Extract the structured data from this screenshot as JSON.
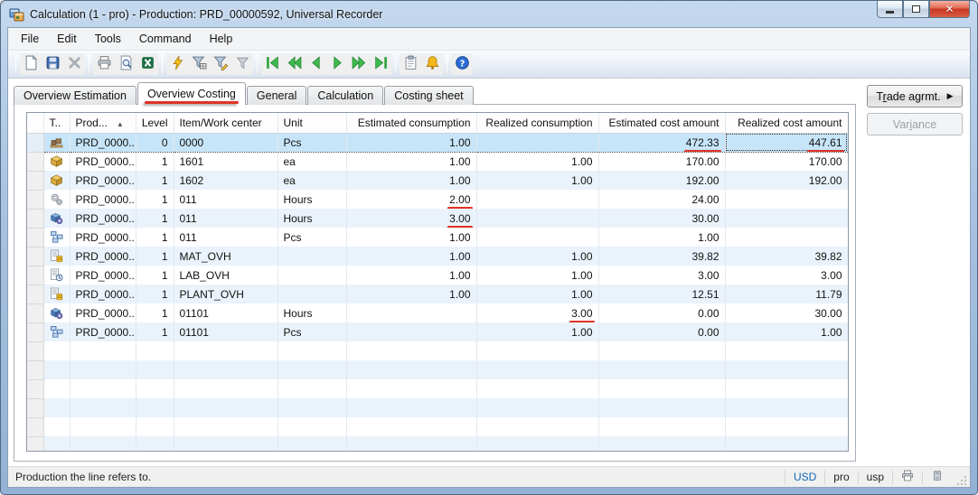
{
  "annotation_color": "#e03226",
  "window": {
    "title": "Calculation (1 - pro) - Production: PRD_00000592, Universal Recorder",
    "app_icon": "form-window-icon",
    "controls": [
      {
        "name": "minimize-button",
        "icon": "minimize-icon"
      },
      {
        "name": "restore-button",
        "icon": "restore-icon"
      },
      {
        "name": "close-button",
        "icon": "close-icon",
        "glyph": "x"
      }
    ]
  },
  "menu": {
    "items": [
      "File",
      "Edit",
      "Tools",
      "Command",
      "Help"
    ]
  },
  "toolbar": {
    "groups": [
      [
        "new-icon",
        "save-icon",
        "delete-icon"
      ],
      [
        "print-icon",
        "print-preview-icon",
        "export-excel-icon"
      ],
      [
        "filter-advanced-icon",
        "filter-grid-icon",
        "filter-field-icon",
        "remove-filter-icon"
      ],
      [
        "first-record-icon",
        "previous-page-icon",
        "previous-record-icon",
        "next-record-icon",
        "next-page-icon",
        "last-record-icon"
      ],
      [
        "document-handling-icon",
        "alerts-icon"
      ],
      [
        "help-icon"
      ]
    ]
  },
  "tabs": {
    "items": [
      {
        "label": "Overview Estimation",
        "active": false,
        "annotated": false
      },
      {
        "label": "Overview Costing",
        "active": true,
        "annotated": true
      },
      {
        "label": "General",
        "active": false,
        "annotated": false
      },
      {
        "label": "Calculation",
        "active": false,
        "annotated": false
      },
      {
        "label": "Costing sheet",
        "active": false,
        "annotated": false
      }
    ]
  },
  "side_buttons": [
    {
      "label": "Trade agrmt.",
      "mnemonic": "r",
      "arrow": true,
      "enabled": true
    },
    {
      "label": "Variance",
      "mnemonic": "i",
      "arrow": false,
      "enabled": false
    }
  ],
  "grid": {
    "columns": [
      {
        "label": "T..",
        "align": "left",
        "sort": ""
      },
      {
        "label": "Prod...",
        "align": "left",
        "sort": "asc"
      },
      {
        "label": "Level",
        "align": "right",
        "sort": ""
      },
      {
        "label": "Item/Work center",
        "align": "left",
        "sort": ""
      },
      {
        "label": "Unit",
        "align": "left",
        "sort": ""
      },
      {
        "label": "Estimated consumption",
        "align": "right",
        "sort": ""
      },
      {
        "label": "Realized consumption",
        "align": "right",
        "sort": ""
      },
      {
        "label": "Estimated cost amount",
        "align": "right",
        "sort": ""
      },
      {
        "label": "Realized cost amount",
        "align": "right",
        "sort": ""
      }
    ],
    "rows": [
      {
        "icon": "pallet-item-icon",
        "prod": "PRD_0000...",
        "level": "0",
        "item": "0000",
        "unit": "Pcs",
        "est_cons": "1.00",
        "real_cons": "",
        "est_cost": "472.33",
        "real_cost": "447.61",
        "selected": true,
        "underline": [
          "est_cost",
          "real_cost"
        ]
      },
      {
        "icon": "item-box-icon",
        "prod": "PRD_0000...",
        "level": "1",
        "item": "1601",
        "unit": "ea",
        "est_cons": "1.00",
        "real_cons": "1.00",
        "est_cost": "170.00",
        "real_cost": "170.00",
        "selected": false,
        "underline": []
      },
      {
        "icon": "item-box-icon",
        "prod": "PRD_0000...",
        "level": "1",
        "item": "1602",
        "unit": "ea",
        "est_cons": "1.00",
        "real_cons": "1.00",
        "est_cost": "192.00",
        "real_cost": "192.00",
        "selected": false,
        "underline": []
      },
      {
        "icon": "setup-gears-icon",
        "prod": "PRD_0000...",
        "level": "1",
        "item": "011",
        "unit": "Hours",
        "est_cons": "2.00",
        "real_cons": "",
        "est_cost": "24.00",
        "real_cost": "",
        "selected": false,
        "underline": [
          "est_cons"
        ]
      },
      {
        "icon": "process-gear-icon",
        "prod": "PRD_0000...",
        "level": "1",
        "item": "011",
        "unit": "Hours",
        "est_cons": "3.00",
        "real_cons": "",
        "est_cost": "30.00",
        "real_cost": "",
        "selected": false,
        "underline": [
          "est_cons"
        ]
      },
      {
        "icon": "quantity-route-icon",
        "prod": "PRD_0000...",
        "level": "1",
        "item": "011",
        "unit": "Pcs",
        "est_cons": "1.00",
        "real_cons": "",
        "est_cost": "1.00",
        "real_cost": "",
        "selected": false,
        "underline": []
      },
      {
        "icon": "overhead-coins-icon",
        "prod": "PRD_0000...",
        "level": "1",
        "item": "MAT_OVH",
        "unit": "",
        "est_cons": "1.00",
        "real_cons": "1.00",
        "est_cost": "39.82",
        "real_cost": "39.82",
        "selected": false,
        "underline": []
      },
      {
        "icon": "overhead-clock-icon",
        "prod": "PRD_0000...",
        "level": "1",
        "item": "LAB_OVH",
        "unit": "",
        "est_cons": "1.00",
        "real_cons": "1.00",
        "est_cost": "3.00",
        "real_cost": "3.00",
        "selected": false,
        "underline": []
      },
      {
        "icon": "overhead-coins-icon",
        "prod": "PRD_0000...",
        "level": "1",
        "item": "PLANT_OVH",
        "unit": "",
        "est_cons": "1.00",
        "real_cons": "1.00",
        "est_cost": "12.51",
        "real_cost": "11.79",
        "selected": false,
        "underline": []
      },
      {
        "icon": "process-gear-icon",
        "prod": "PRD_0000...",
        "level": "1",
        "item": "01101",
        "unit": "Hours",
        "est_cons": "",
        "real_cons": "3.00",
        "est_cost": "0.00",
        "real_cost": "30.00",
        "selected": false,
        "underline": [
          "real_cons"
        ]
      },
      {
        "icon": "quantity-route-icon",
        "prod": "PRD_0000...",
        "level": "1",
        "item": "01101",
        "unit": "Pcs",
        "est_cons": "",
        "real_cons": "1.00",
        "est_cost": "0.00",
        "real_cost": "1.00",
        "selected": false,
        "underline": []
      }
    ],
    "empty_rows": 6
  },
  "status_bar": {
    "message": "Production the line refers to.",
    "segments": [
      "USD",
      "pro",
      "usp"
    ],
    "icons": [
      "printer-icon",
      "database-icon"
    ]
  }
}
